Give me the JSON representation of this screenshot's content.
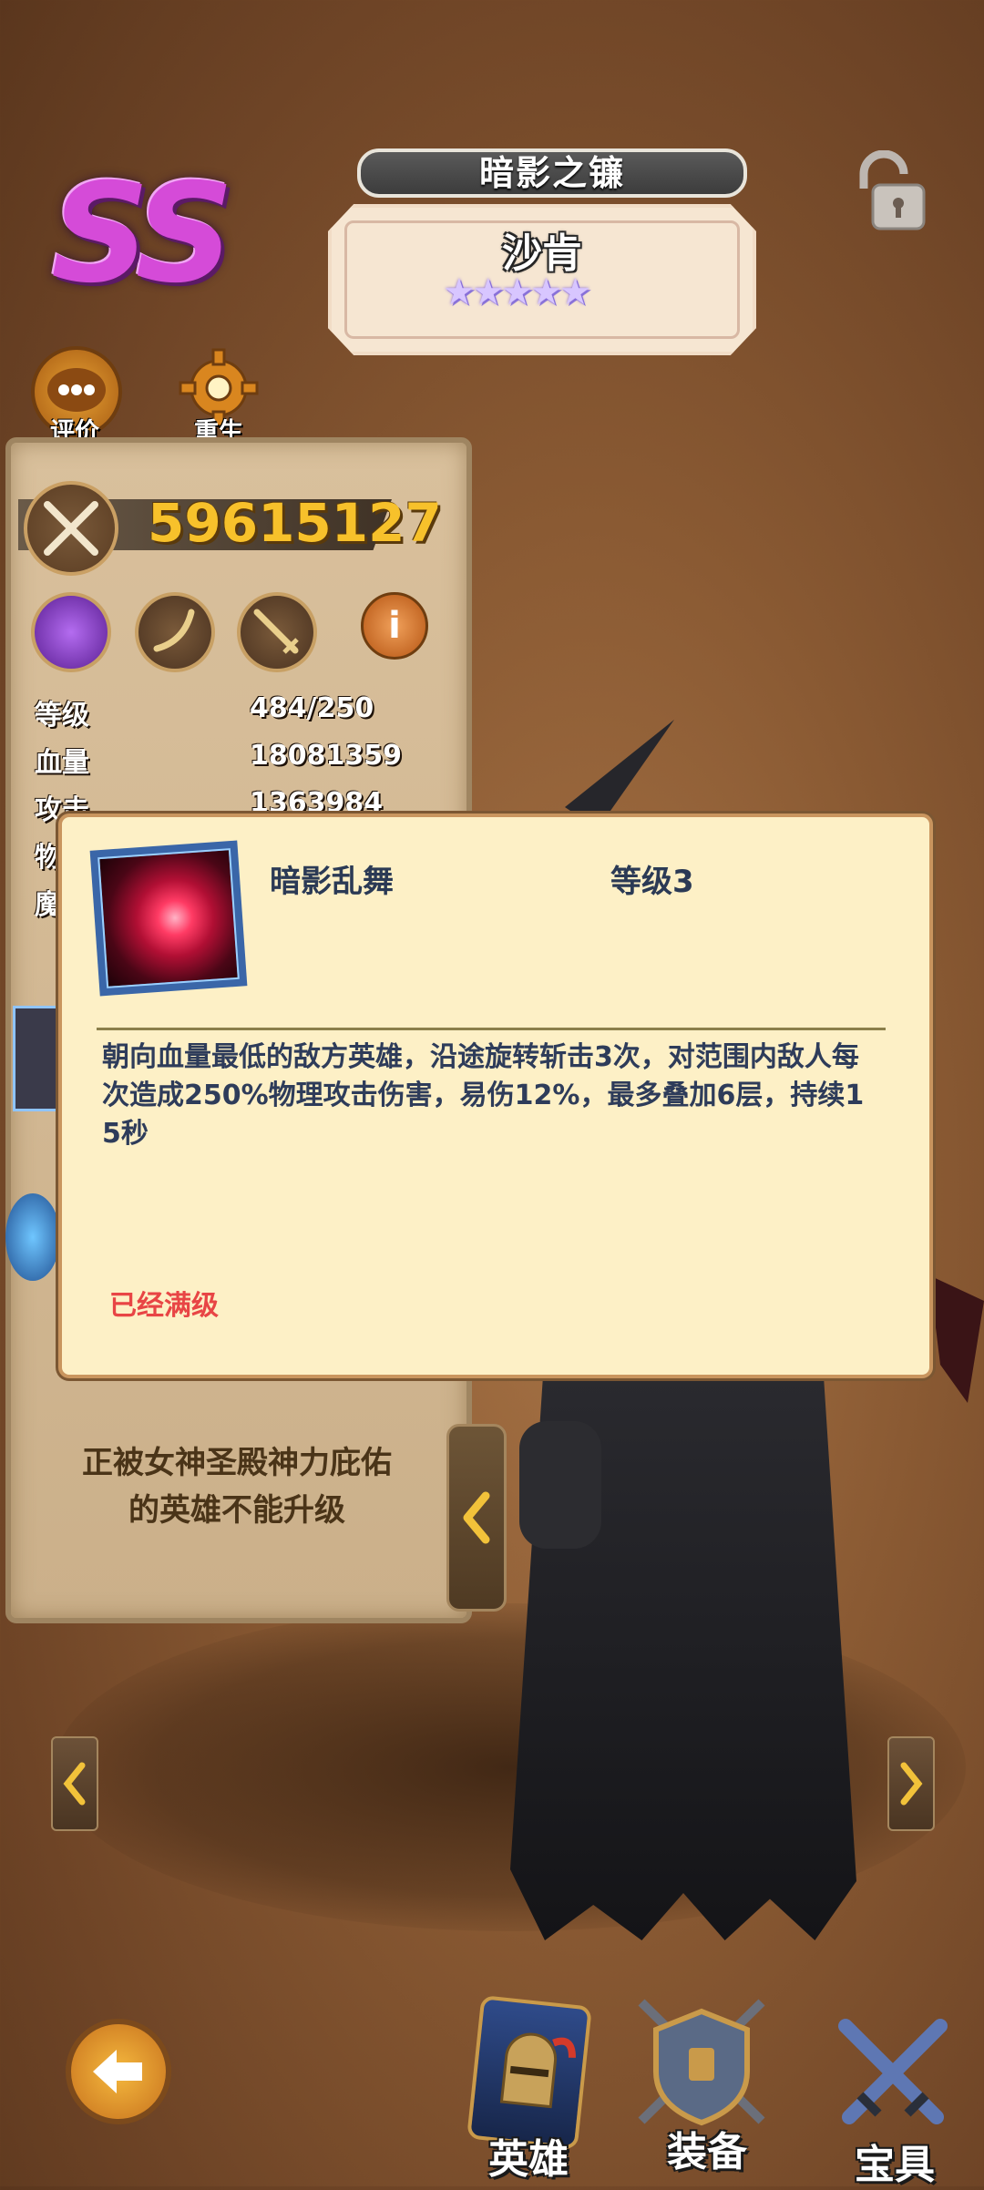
{
  "hero": {
    "title": "暗影之镰",
    "name": "沙肯",
    "grade": "SS",
    "stars": [
      "★",
      "★",
      "★",
      "★",
      "★"
    ]
  },
  "top_buttons": {
    "review_label": "评价",
    "rebirth_label": "重生"
  },
  "power": "59615127",
  "stats": [
    {
      "label": "等级",
      "value": "484/250"
    },
    {
      "label": "血量",
      "value": "18081359"
    },
    {
      "label": "攻击",
      "value": "1363984"
    },
    {
      "label": "物",
      "value": ""
    },
    {
      "label": "魔",
      "value": ""
    }
  ],
  "panel_notice": {
    "line1": "正被女神圣殿神力庇佑",
    "line2": "的英雄不能升级"
  },
  "skill_popup": {
    "name": "暗影乱舞",
    "level": "等级3",
    "description": "朝向血量最低的敌方英雄，沿途旋转斩击3次，对范围内敌人每次造成250%物理攻击伤害，易伤12%，最多叠加6层，持续15秒",
    "status": "已经满级"
  },
  "bottom_tabs": {
    "heroes": "英雄",
    "equipment": "装备",
    "treasure": "宝具"
  },
  "colors": {
    "power": "#f7c12b",
    "maxed": "#e84545",
    "grade": "#d54bd8"
  }
}
